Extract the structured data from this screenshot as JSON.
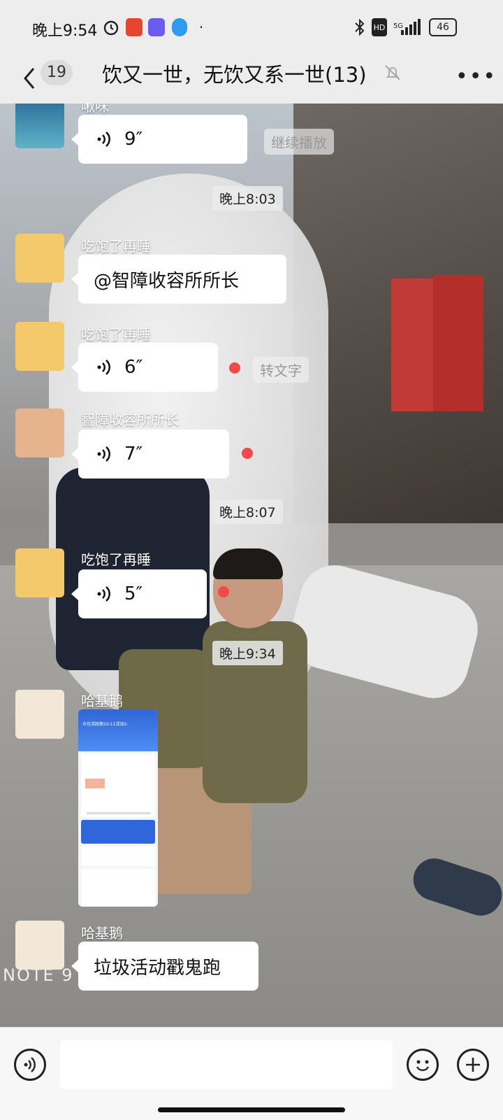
{
  "status": {
    "time": "晚上9:54",
    "network": "5G",
    "battery": "46"
  },
  "header": {
    "unread": "19",
    "title": "饮又一世，无饮又系一世(13)"
  },
  "messages": [
    {
      "sender": "啾咪",
      "duration": "9″",
      "hint": "继续播放"
    },
    {
      "time": "晚上8:03"
    },
    {
      "sender": "吃饱了再睡",
      "text": "@智障收容所所长"
    },
    {
      "sender": "吃饱了再睡",
      "duration": "6″",
      "hint": "转文字"
    },
    {
      "sender": "智障收容所所长",
      "duration": "7″"
    },
    {
      "time": "晚上8:07"
    },
    {
      "sender": "吃饱了再睡",
      "duration": "5″"
    },
    {
      "time": "晚上9:34"
    },
    {
      "sender": "哈基鹅",
      "image": "screenshot"
    },
    {
      "sender": "哈基鹅",
      "text": "垃圾活动戳鬼跑"
    }
  ],
  "shot": {
    "title": "众包活跃期10-11活动2-"
  },
  "watermark": "NOTE 9 P",
  "icons": [
    "back-icon",
    "bell-off-icon",
    "more-icon",
    "voice-input-icon",
    "emoji-icon",
    "plus-icon"
  ]
}
